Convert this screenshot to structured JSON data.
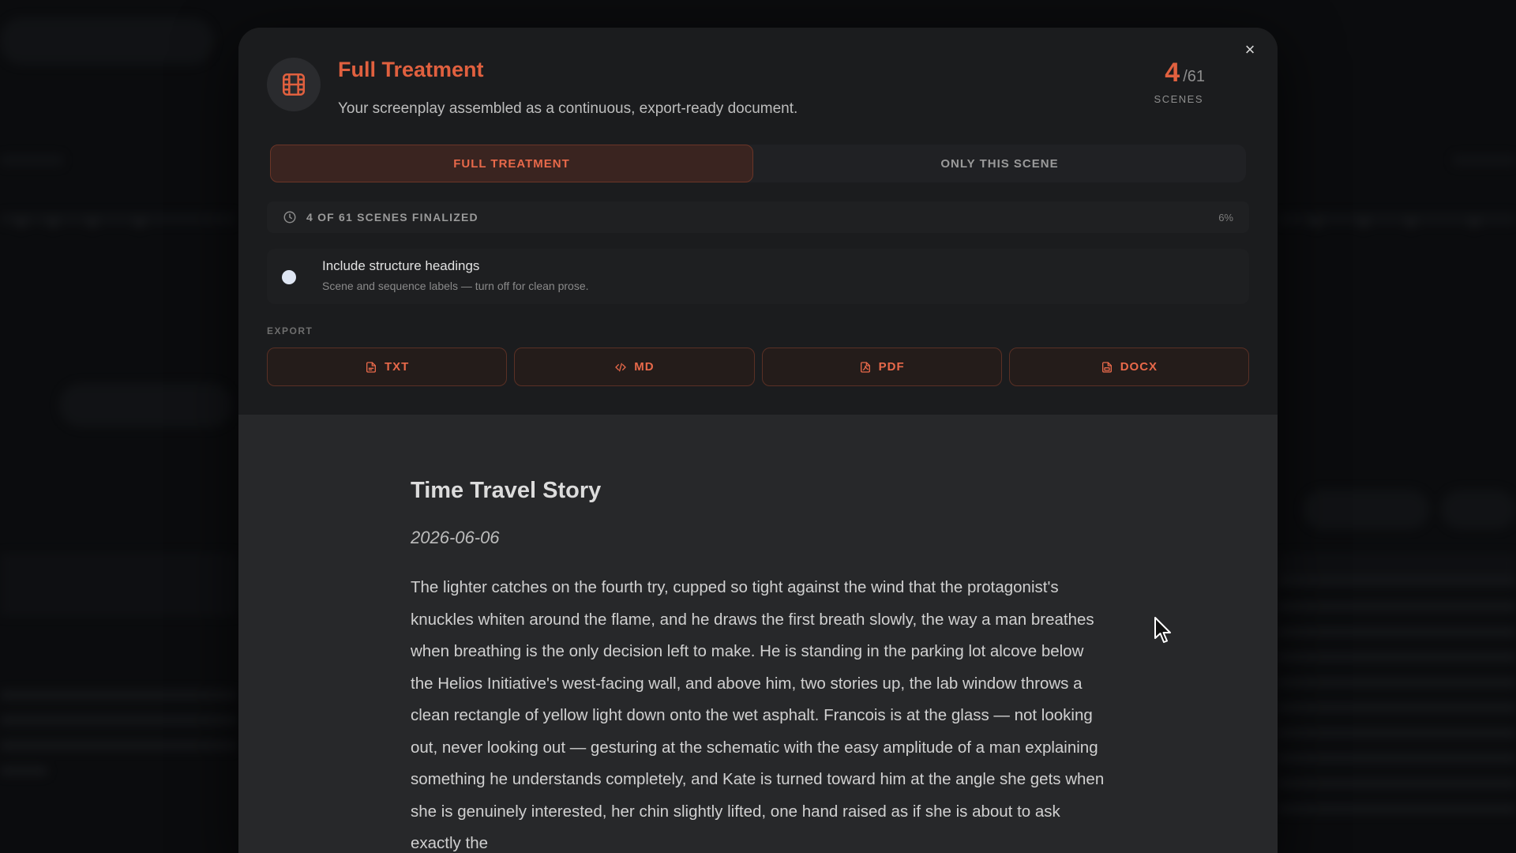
{
  "modal": {
    "title": "Full Treatment",
    "subtitle": "Your screenplay assembled as a continuous, export-ready document.",
    "scene_count": "4",
    "scene_total": "/61",
    "scene_label": "SCENES",
    "close_glyph": "×"
  },
  "tabs": {
    "full": "FULL TREATMENT",
    "single": "ONLY THIS SCENE"
  },
  "progress": {
    "label": "4 OF 61 SCENES FINALIZED",
    "percent": "6%",
    "fraction": 0.06
  },
  "headings_option": {
    "title": "Include structure headings",
    "description": "Scene and sequence labels — turn off for clean prose."
  },
  "export": {
    "label": "EXPORT",
    "buttons": [
      {
        "label": "TXT",
        "icon": "file-text-icon"
      },
      {
        "label": "MD",
        "icon": "code-icon"
      },
      {
        "label": "PDF",
        "icon": "file-pdf-icon"
      },
      {
        "label": "DOCX",
        "icon": "file-doc-icon"
      }
    ]
  },
  "document": {
    "title": "Time Travel Story",
    "date": "2026-06-06",
    "body": "The lighter catches on the fourth try, cupped so tight against the wind that the protagonist's knuckles whiten around the flame, and he draws the first breath slowly, the way a man breathes when breathing is the only decision left to make. He is standing in the parking lot alcove below the Helios Initiative's west-facing wall, and above him, two stories up, the lab window throws a clean rectangle of yellow light down onto the wet asphalt. Francois is at the glass — not looking out, never looking out — gesturing at the schematic with the easy amplitude of a man explaining something he understands completely, and Kate is turned toward him at the angle she gets when she is genuinely interested, her chin slightly lifted, one hand raised as if she is about to ask exactly the"
  },
  "colors": {
    "accent": "#e0603f",
    "modal_bg": "#1b1c1e",
    "doc_bg": "#27282a"
  }
}
